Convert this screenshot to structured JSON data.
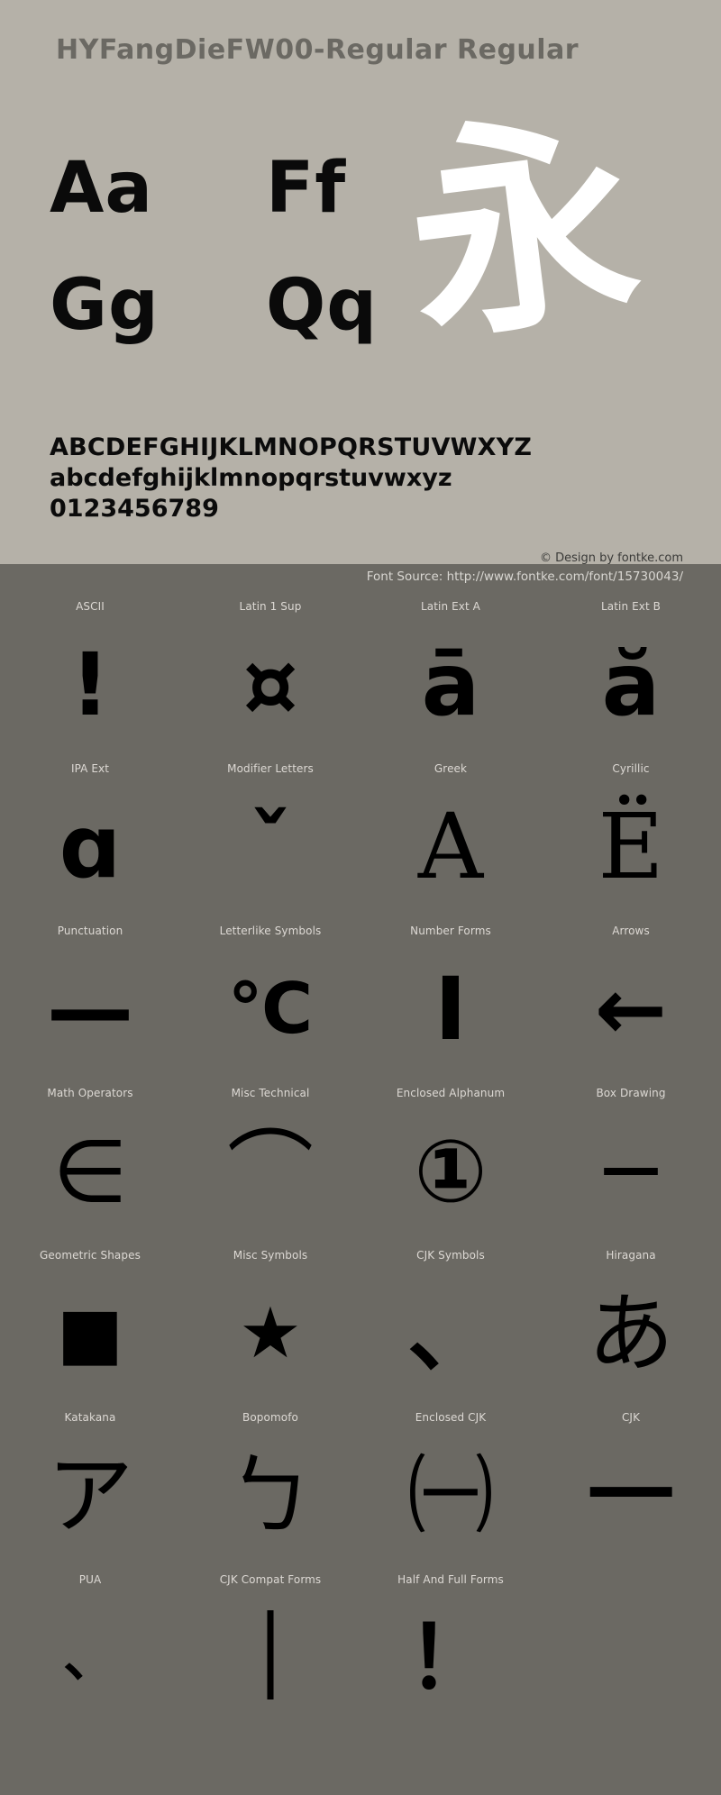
{
  "specimen": {
    "title": "HYFangDieFW00-Regular Regular",
    "letter_pairs": [
      "Aa",
      "Ff",
      "Gg",
      "Qq"
    ],
    "showcase_glyph": "永",
    "alphabet_uppercase": "ABCDEFGHIJKLMNOPQRSTUVWXYZ",
    "alphabet_lowercase": "abcdefghijklmnopqrstuvwxyz",
    "digits": "0123456789",
    "copyright": "© Design by fontke.com",
    "colors": {
      "panel_background": "#b5b1a8",
      "grid_background": "#6b6963",
      "title_text": "#6b6963",
      "glyph_black": "#000000",
      "showcase_white": "#ffffff",
      "label_text": "#ddd9d4"
    }
  },
  "source_bar": {
    "text": "Font Source: http://www.fontke.com/font/15730043/"
  },
  "block_grid": {
    "rows": [
      [
        {
          "label": "ASCII",
          "glyph": "!",
          "style": ""
        },
        {
          "label": "Latin 1 Sup",
          "glyph": "¤",
          "style": ""
        },
        {
          "label": "Latin Ext A",
          "glyph": "ā",
          "style": ""
        },
        {
          "label": "Latin Ext B",
          "glyph": "ă",
          "style": ""
        }
      ],
      [
        {
          "label": "IPA Ext",
          "glyph": "ɑ",
          "style": ""
        },
        {
          "label": "Modifier Letters",
          "glyph": "ˇ",
          "style": ""
        },
        {
          "label": "Greek",
          "glyph": "Α",
          "style": "serif"
        },
        {
          "label": "Cyrillic",
          "glyph": "Ё",
          "style": "serif"
        }
      ],
      [
        {
          "label": "Punctuation",
          "glyph": "—",
          "style": ""
        },
        {
          "label": "Letterlike Symbols",
          "glyph": "℃",
          "style": "small"
        },
        {
          "label": "Number Forms",
          "glyph": "Ⅰ",
          "style": ""
        },
        {
          "label": "Arrows",
          "glyph": "←",
          "style": ""
        }
      ],
      [
        {
          "label": "Math Operators",
          "glyph": "∈",
          "style": "thin"
        },
        {
          "label": "Misc Technical",
          "glyph": "⌒",
          "style": "thin"
        },
        {
          "label": "Enclosed Alphanum",
          "glyph": "①",
          "style": ""
        },
        {
          "label": "Box Drawing",
          "glyph": "─",
          "style": ""
        }
      ],
      [
        {
          "label": "Geometric Shapes",
          "glyph": "■",
          "style": "small"
        },
        {
          "label": "Misc Symbols",
          "glyph": "★",
          "style": "small"
        },
        {
          "label": "CJK Symbols",
          "glyph": "、",
          "style": ""
        },
        {
          "label": "Hiragana",
          "glyph": "あ",
          "style": "thin"
        }
      ],
      [
        {
          "label": "Katakana",
          "glyph": "ア",
          "style": "thin"
        },
        {
          "label": "Bopomofo",
          "glyph": "ㄅ",
          "style": "thin"
        },
        {
          "label": "Enclosed CJK",
          "glyph": "㈠",
          "style": "thin"
        },
        {
          "label": "CJK",
          "glyph": "一",
          "style": ""
        }
      ],
      [
        {
          "label": "PUA",
          "glyph": "、",
          "style": "tiny"
        },
        {
          "label": "CJK Compat Forms",
          "glyph": "｜",
          "style": ""
        },
        {
          "label": "Half And Full Forms",
          "glyph": "！",
          "style": ""
        },
        {
          "label": "",
          "glyph": "",
          "style": "empty"
        }
      ]
    ]
  }
}
